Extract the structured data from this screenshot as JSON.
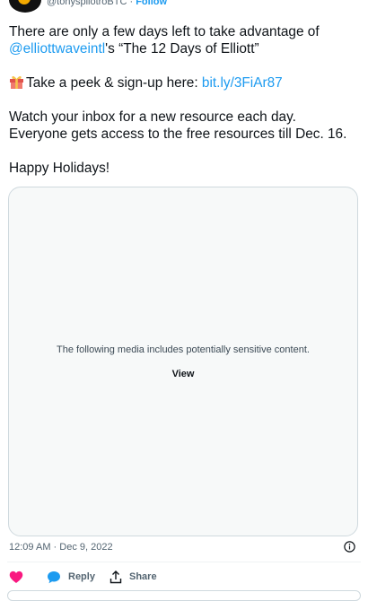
{
  "header": {
    "handle": "@tonyspilotroBTC",
    "separator": " · ",
    "follow_label": "Follow"
  },
  "tweet": {
    "line1_text": "There are only a few days left to take advantage of",
    "mention": "@elliottwaveintl",
    "line2_text": "'s “The 12 Days of Elliott”",
    "promo_text": "Take a peek & sign-up here: ",
    "promo_link": "bit.ly/3FiAr87",
    "paragraph3_line1": "Watch your inbox for a new resource each day.",
    "paragraph3_line2": "Everyone gets access to the free resources till Dec. 16.",
    "closing": "Happy Holidays!"
  },
  "media": {
    "warning": "The following media includes potentially sensitive content.",
    "view_label": "View"
  },
  "meta": {
    "timestamp": "12:09 AM · Dec 9, 2022"
  },
  "actions": {
    "reply_label": "Reply",
    "share_label": "Share"
  },
  "colors": {
    "link": "#1d9bf0",
    "like": "#f91880",
    "text": "#0f1419",
    "muted": "#536471"
  },
  "icons": [
    "gift-icon",
    "info-icon",
    "heart-icon",
    "reply-bubble-icon",
    "share-icon"
  ]
}
